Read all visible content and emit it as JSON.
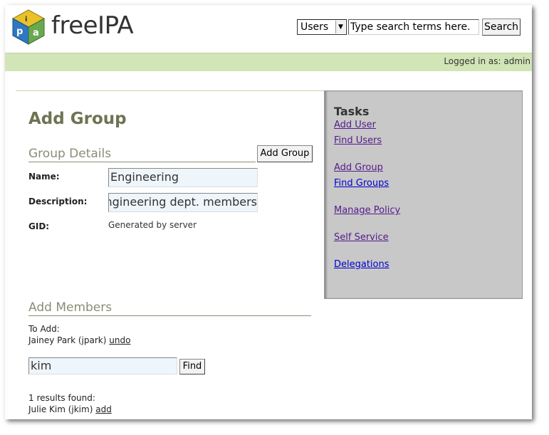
{
  "header": {
    "app_name": "freeIPA",
    "search": {
      "scope_selected": "Users",
      "placeholder": "Type search terms here.",
      "button_label": "Search"
    }
  },
  "status_bar": {
    "logged_in_text": "Logged in as: admin"
  },
  "main": {
    "page_title": "Add Group",
    "group_details": {
      "section_title": "Group Details",
      "add_button_label": "Add Group",
      "name_label": "Name:",
      "name_value": "Engineering",
      "description_label": "Description:",
      "description_value": "Engineering dept. members",
      "gid_label": "GID:",
      "gid_value": "Generated by server"
    },
    "add_members": {
      "section_title": "Add Members",
      "to_add_label": "To Add:",
      "pending": [
        {
          "name": "Jainey Park (jpark)",
          "action": "undo"
        }
      ],
      "search_value": "kim",
      "find_button_label": "Find",
      "results_summary": "1 results found:",
      "results": [
        {
          "name": "Julie Kim (jkim)",
          "action": "add"
        }
      ]
    }
  },
  "sidebar": {
    "title": "Tasks",
    "links": [
      {
        "label": "Add User"
      },
      {
        "label": "Find Users"
      },
      {
        "label": "Add Group"
      },
      {
        "label": "Find Groups"
      },
      {
        "label": "Manage Policy"
      },
      {
        "label": "Self Service"
      },
      {
        "label": "Delegations"
      }
    ]
  }
}
